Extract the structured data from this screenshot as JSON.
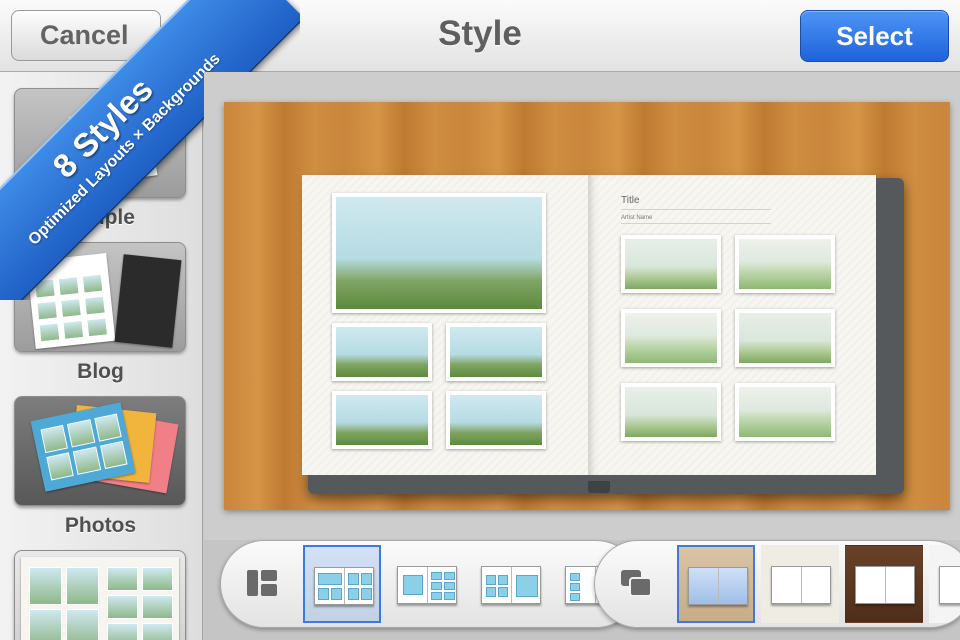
{
  "header": {
    "title": "Style",
    "cancel_label": "Cancel",
    "select_label": "Select"
  },
  "banner": {
    "title": "8 Styles",
    "subtitle": "Optimized Layouts × Backgrounds"
  },
  "styles": [
    {
      "label": "Simple",
      "selected": false
    },
    {
      "label": "Blog",
      "selected": false
    },
    {
      "label": "Photos",
      "selected": true
    },
    {
      "label": "",
      "selected": false
    }
  ],
  "preview": {
    "page_title": "Title",
    "artist_name": "Artist Name"
  },
  "toolbar": {
    "layout_icon": "layout-icon",
    "background_icon": "background-icon",
    "layouts_selected_index": 0,
    "backgrounds_selected_index": 0
  },
  "colors": {
    "accent": "#1e63dc",
    "wood": "#c9863c"
  }
}
